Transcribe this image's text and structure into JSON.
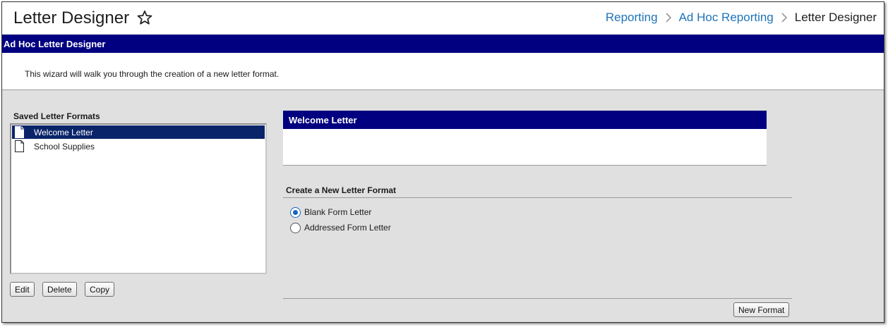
{
  "header": {
    "title": "Letter Designer",
    "breadcrumbs": [
      "Reporting",
      "Ad Hoc Reporting",
      "Letter Designer"
    ]
  },
  "tool": {
    "title": "Ad Hoc Letter Designer",
    "intro": "This wizard will walk you through the creation of a new letter format."
  },
  "saved": {
    "label": "Saved Letter Formats",
    "items": [
      {
        "label": "Welcome Letter",
        "selected": true
      },
      {
        "label": "School Supplies",
        "selected": false
      }
    ],
    "buttons": {
      "edit": "Edit",
      "delete": "Delete",
      "copy": "Copy"
    }
  },
  "preview": {
    "title": "Welcome Letter"
  },
  "create": {
    "label": "Create a New Letter Format",
    "options": [
      {
        "label": "Blank Form Letter",
        "checked": true
      },
      {
        "label": "Addressed Form Letter",
        "checked": false
      }
    ],
    "new_button": "New Format"
  },
  "colors": {
    "nav_blue": "#000080",
    "link_blue": "#1f74b8",
    "selection": "#0a246a",
    "panel_gray": "#e0e0e0"
  }
}
